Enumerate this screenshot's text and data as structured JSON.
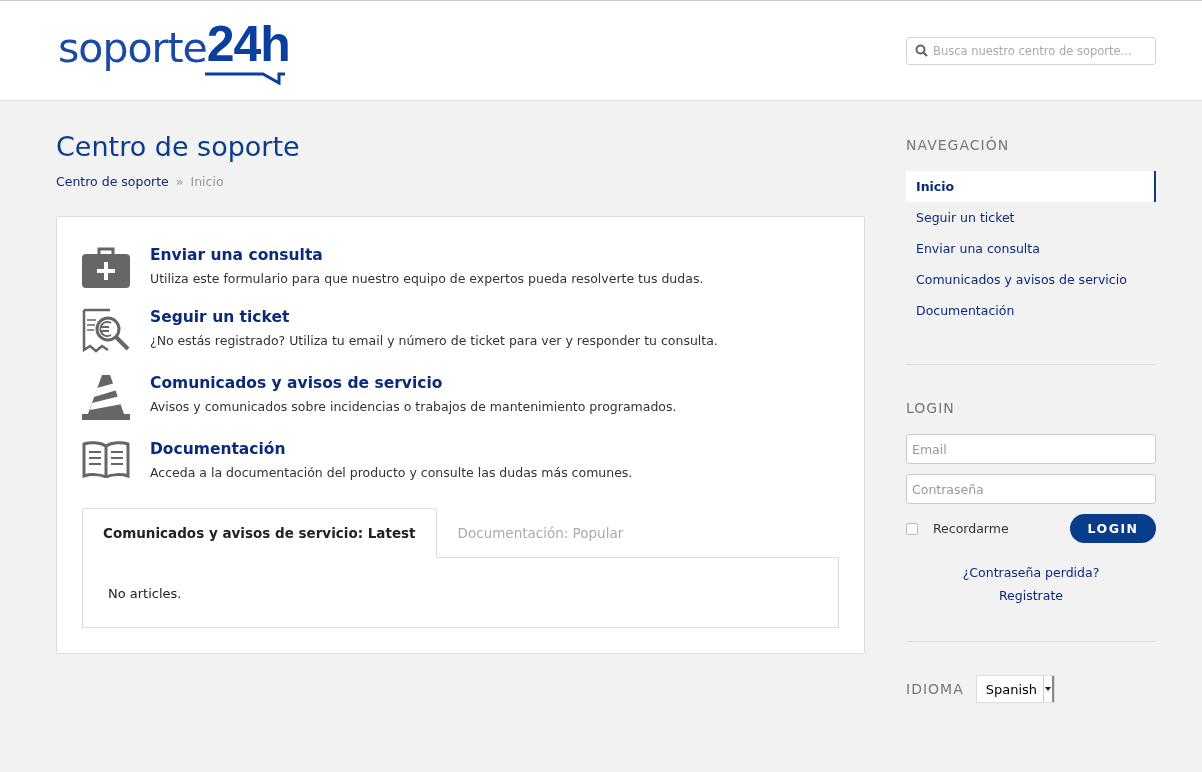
{
  "header": {
    "logo": {
      "text": "soporte",
      "accent": "24h"
    },
    "search": {
      "placeholder": "Busca nuestro centro de soporte..."
    }
  },
  "page": {
    "title": "Centro de soporte",
    "breadcrumb": [
      {
        "label": "Centro de soporte",
        "kind": "link"
      },
      {
        "label": "»",
        "kind": "separator"
      },
      {
        "label": "Inicio",
        "kind": "current"
      }
    ]
  },
  "sections": [
    {
      "kind": "medkit",
      "title": "Enviar una consulta",
      "description": "Utiliza este formulario para que nuestro equipo de expertos pueda resolverte tus dudas."
    },
    {
      "kind": "receipt",
      "title": "Seguir un ticket",
      "description": "¿No estás registrado? Utiliza tu email y número de ticket para ver y responder tu consulta."
    },
    {
      "kind": "cone",
      "title": "Comunicados y avisos de servicio",
      "description": "Avisos y comunicados sobre incidencias o trabajos de mantenimiento programados."
    },
    {
      "kind": "book",
      "title": "Documentación",
      "description": "Acceda a la documentación del producto y consulte las dudas más comunes."
    }
  ],
  "tabs": [
    {
      "label": "Comunicados y avisos de servicio: Latest",
      "selected": true
    },
    {
      "label": "Documentación: Popular",
      "selected": false
    }
  ],
  "tab_content": "No articles.",
  "sidebar": {
    "navigation": {
      "heading": "NAVEGACIÓN",
      "items": [
        {
          "label": "Inicio",
          "selected": true
        },
        {
          "label": "Seguir un ticket",
          "selected": false
        },
        {
          "label": "Enviar una consulta",
          "selected": false
        },
        {
          "label": "Comunicados y avisos de servicio",
          "selected": false
        },
        {
          "label": "Documentación",
          "selected": false
        }
      ]
    },
    "login": {
      "heading": "LOGIN",
      "email_placeholder": "Email",
      "password_placeholder": "Contraseña",
      "remember": {
        "label": "Recordarme",
        "checked": false
      },
      "button": "LOGIN",
      "links": [
        "¿Contraseña perdida?",
        "Registrate"
      ]
    },
    "language": {
      "label": "IDIOMA",
      "value": "Spanish"
    }
  }
}
